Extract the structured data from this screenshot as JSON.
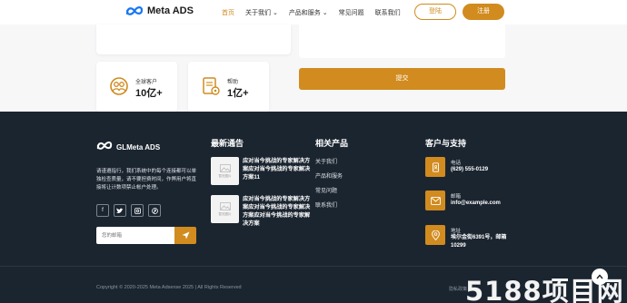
{
  "header": {
    "logo_text": "Meta ADS",
    "nav": [
      {
        "label": "首页",
        "active": true
      },
      {
        "label": "关于我们 ⌄",
        "active": false
      },
      {
        "label": "产品和服务 ⌄",
        "active": false
      },
      {
        "label": "常见问题",
        "active": false
      },
      {
        "label": "联系我们",
        "active": false
      }
    ],
    "login_label": "登陆",
    "register_label": "注册"
  },
  "form": {
    "submit_label": "提交"
  },
  "stats": [
    {
      "label": "全球客户",
      "value": "10亿+",
      "icon": "users-money-icon"
    },
    {
      "label": "帮助",
      "value": "1亿+",
      "icon": "document-gear-icon"
    }
  ],
  "footer": {
    "logo_text": "GLMeta ADS",
    "description": "请谨遵指行，我们系统中的每个连接都可以单独检查质量，请不要担费时间，作弊用户将直接将让计数项禁止帐户处理。",
    "socials": [
      "f",
      "t",
      "ig",
      "p"
    ],
    "email_placeholder": "您的邮箱",
    "news_title": "最新通告",
    "news": [
      {
        "text": "应对当今挑战的专家解决方案应对当今挑战的专家解决方案11",
        "thumb_label": "暂无图片"
      },
      {
        "text": "应对当今挑战的专家解决方案应对当今挑战的专家解决方案应对当今挑战的专家解决方案",
        "thumb_label": "暂无图片"
      }
    ],
    "products_title": "相关产品",
    "products": [
      "关于我们",
      "产品和服务",
      "常见问题",
      "联系我们"
    ],
    "contact_title": "客户与支持",
    "contacts": [
      {
        "label": "电话",
        "value": "(629) 555-0129",
        "icon": "phone-icon"
      },
      {
        "label": "邮箱",
        "value": "info@example.com",
        "icon": "mail-icon"
      },
      {
        "label": "地址",
        "value": "埃尔金街6391号，邮箱",
        "value2": "10299",
        "icon": "location-icon"
      }
    ],
    "copyright": "Copyright © 2020-2025 Meta Adsense 2025 | All Rights Reserved",
    "links": "隐私政策"
  },
  "watermark": "5188项目网",
  "colors": {
    "accent": "#d18b1f",
    "footer_bg": "#1b2530"
  }
}
